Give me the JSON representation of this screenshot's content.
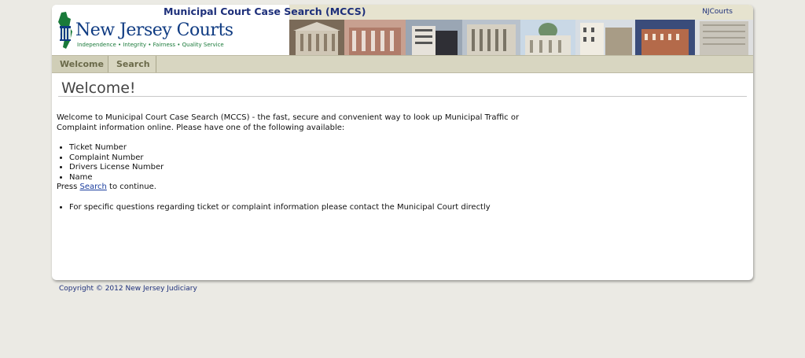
{
  "header": {
    "app_title": "Municipal Court Case Search (MCCS)",
    "njcourts_link": "NJCourts",
    "logo_title": "New Jersey Courts",
    "logo_tagline": "Independence • Integrity • Fairness • Quality Service"
  },
  "nav": {
    "tabs": [
      {
        "label": "Welcome",
        "active": true
      },
      {
        "label": "Search",
        "active": false
      }
    ]
  },
  "main": {
    "page_title": "Welcome!",
    "intro": "Welcome to Municipal Court Case Search (MCCS) - the fast, secure and convenient way to look up Municipal Traffic or Complaint information online. Please have one of the following available:",
    "required_items": [
      "Ticket Number",
      "Complaint Number",
      "Drivers License Number",
      "Name"
    ],
    "press_prefix": "Press ",
    "press_link": "Search",
    "press_suffix": " to continue.",
    "notes": [
      "For specific questions regarding ticket or complaint information please contact the Municipal Court directly"
    ]
  },
  "footer": {
    "copyright": "Copyright © 2012 New Jersey Judiciary"
  },
  "colors": {
    "page_bg": "#ebeae4",
    "nav_bg": "#d8d6c1",
    "title_blue": "#1d2f7a",
    "logo_green": "#1a7a3a"
  }
}
